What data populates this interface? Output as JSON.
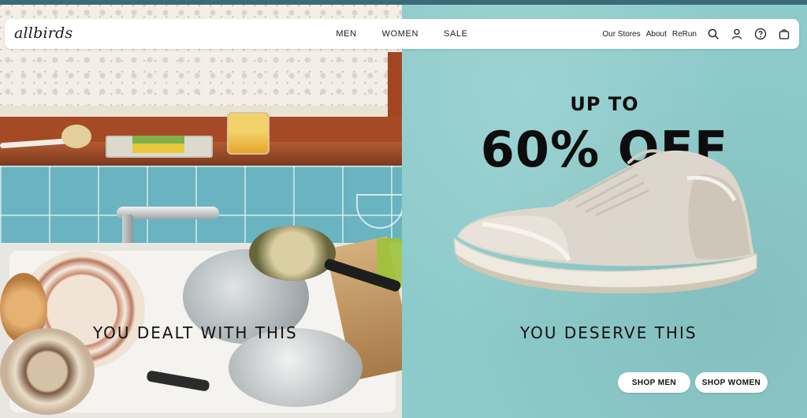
{
  "brand": {
    "logo_text": "allbirds"
  },
  "nav": {
    "main": [
      "MEN",
      "WOMEN",
      "SALE"
    ],
    "secondary": [
      "Our Stores",
      "About",
      "ReRun"
    ],
    "icons": [
      "search-icon",
      "account-icon",
      "help-icon",
      "cart-icon"
    ]
  },
  "hero": {
    "promo_line1": "UP TO",
    "promo_line2": "60% OFF",
    "left_caption": "YOU DEALT WITH THIS",
    "right_caption": "YOU DESERVE THIS",
    "buttons": {
      "shop_men": "SHOP MEN",
      "shop_women": "SHOP WOMEN"
    }
  },
  "colors": {
    "promo_background": "#8ccbca",
    "tile_blue": "#69b4c0",
    "button_bg": "#ffffff",
    "text": "#0d0d0d"
  }
}
